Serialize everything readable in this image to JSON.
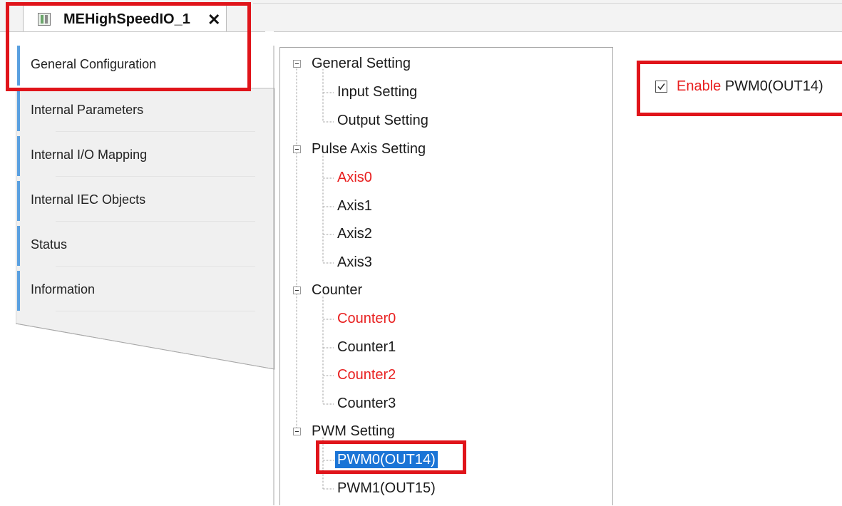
{
  "tab": {
    "title": "MEHighSpeedIO_1",
    "close_glyph": "✕",
    "icon": "device-module-icon"
  },
  "nav": {
    "items": [
      {
        "label": "General Configuration",
        "selected": true
      },
      {
        "label": "Internal Parameters"
      },
      {
        "label": "Internal I/O Mapping"
      },
      {
        "label": "Internal IEC Objects"
      },
      {
        "label": "Status"
      },
      {
        "label": "Information"
      }
    ],
    "accent_color": "#5aa0e0"
  },
  "tree": {
    "groups": [
      {
        "label": "General Setting",
        "children": [
          {
            "label": "Input Setting"
          },
          {
            "label": "Output Setting"
          }
        ]
      },
      {
        "label": "Pulse Axis Setting",
        "children": [
          {
            "label": "Axis0",
            "highlight": "red"
          },
          {
            "label": "Axis1"
          },
          {
            "label": "Axis2"
          },
          {
            "label": "Axis3"
          }
        ]
      },
      {
        "label": "Counter",
        "children": [
          {
            "label": "Counter0",
            "highlight": "red"
          },
          {
            "label": "Counter1"
          },
          {
            "label": "Counter2",
            "highlight": "red"
          },
          {
            "label": "Counter3"
          }
        ]
      },
      {
        "label": "PWM Setting",
        "children": [
          {
            "label": "PWM0(OUT14)",
            "selected": true
          },
          {
            "label": "PWM1(OUT15)"
          }
        ]
      }
    ],
    "selected_color": "#1a74d6",
    "red_color": "#e82020"
  },
  "settings": {
    "enable_checked": true,
    "enable_word": "Enable",
    "enable_target": "PWM0(OUT14)"
  },
  "annotation_color": "#e0141a"
}
